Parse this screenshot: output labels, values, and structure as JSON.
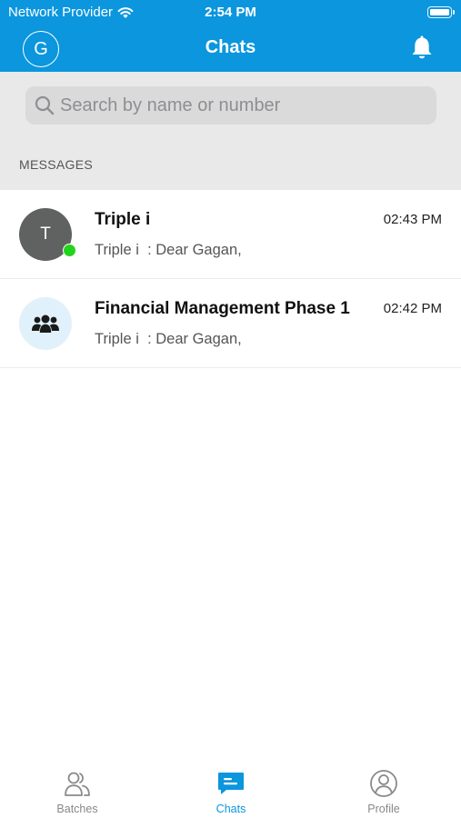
{
  "status_bar": {
    "carrier": "Network Provider",
    "time": "2:54 PM"
  },
  "header": {
    "avatar_letter": "G",
    "title": "Chats"
  },
  "search": {
    "placeholder": "Search by name or number",
    "value": ""
  },
  "section_label": "MESSAGES",
  "chats": [
    {
      "name": "Triple i",
      "time": "02:43 PM",
      "preview": "Triple i  : Dear Gagan,",
      "avatar_letter": "T",
      "online": true
    },
    {
      "name": "Financial Management Phase 1",
      "time": "02:42 PM",
      "preview": "Triple i  : Dear Gagan,",
      "avatar_icon": "group-icon"
    }
  ],
  "tabs": [
    {
      "label": "Batches",
      "icon": "batches-icon",
      "active": false
    },
    {
      "label": "Chats",
      "icon": "chat-icon",
      "active": true
    },
    {
      "label": "Profile",
      "icon": "profile-icon",
      "active": false
    }
  ],
  "colors": {
    "brand": "#0b96de",
    "online": "#22d41c",
    "search_area_bg": "#e9e9e9"
  }
}
